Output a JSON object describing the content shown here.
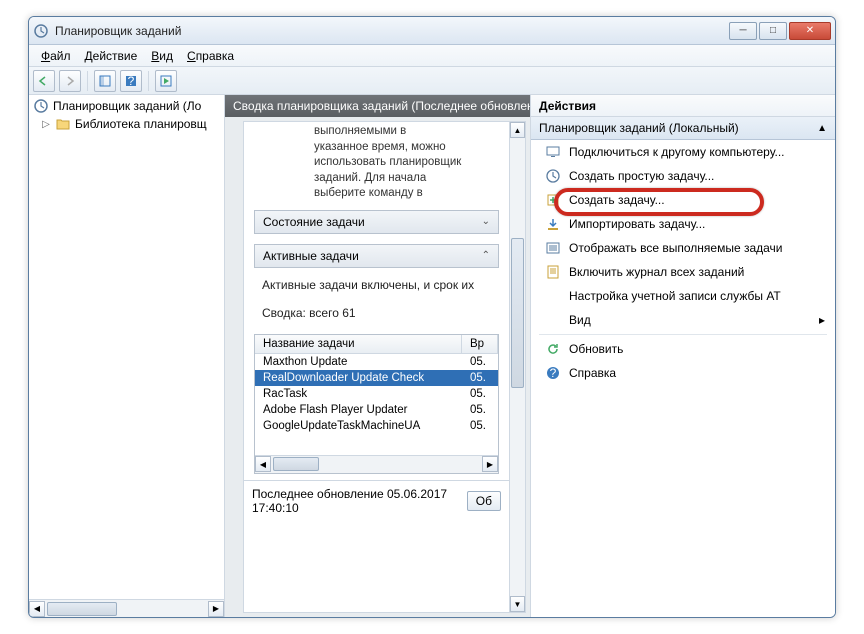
{
  "window": {
    "title": "Планировщик заданий"
  },
  "menu": {
    "file": "Файл",
    "action": "Действие",
    "view": "Вид",
    "help": "Справка"
  },
  "tree": {
    "root": "Планировщик заданий (Локальный)",
    "rootShown": "Планировщик заданий (Ло",
    "lib": "Библиотека планировщика",
    "libShown": "Библиотека планировщ"
  },
  "mid": {
    "header": "Сводка планировщика заданий (Последнее обновлен",
    "desc": "выполняемыми в указанное время, можно использовать планировщик заданий. Для начала выберите команду в",
    "section_state": "Состояние задачи",
    "section_active": "Активные задачи",
    "active_on": "Активные задачи включены, и срок их",
    "summary": "Сводка: всего 61",
    "col_name": "Название задачи",
    "col_time": "Вр",
    "rows": [
      {
        "name": "Maxthon Update",
        "date": "05."
      },
      {
        "name": "RealDownloader Update Check",
        "date": "05."
      },
      {
        "name": "RacTask",
        "date": "05."
      },
      {
        "name": "Adobe Flash Player Updater",
        "date": "05."
      },
      {
        "name": "GoogleUpdateTaskMachineUA",
        "date": "05."
      }
    ],
    "selectedIndex": 1,
    "footer": "Последнее обновление 05.06.2017 17:40:10",
    "refresh_btn": "Об"
  },
  "actions": {
    "title": "Действия",
    "group": "Планировщик заданий (Локальный)",
    "items": [
      {
        "icon": "computer-icon",
        "label": "Подключиться к другому компьютеру..."
      },
      {
        "icon": "clock-icon",
        "label": "Создать простую задачу..."
      },
      {
        "icon": "task-new-icon",
        "label": "Создать задачу..."
      },
      {
        "icon": "import-icon",
        "label": "Импортировать задачу..."
      },
      {
        "icon": "running-tasks-icon",
        "label": "Отображать все выполняемые задачи"
      },
      {
        "icon": "log-icon",
        "label": "Включить журнал всех заданий"
      },
      {
        "icon": "",
        "label": "Настройка учетной записи службы AT"
      },
      {
        "icon": "",
        "label": "Вид",
        "submenu": true
      }
    ],
    "extra": [
      {
        "icon": "refresh-icon",
        "label": "Обновить"
      },
      {
        "icon": "help-icon",
        "label": "Справка"
      }
    ]
  }
}
